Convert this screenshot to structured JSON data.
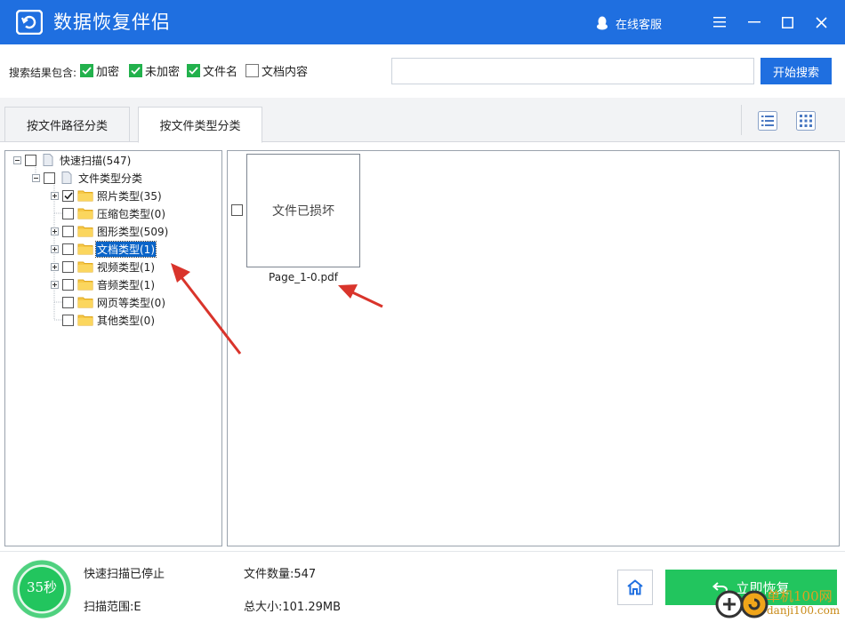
{
  "app": {
    "title": "数据恢复伴侣",
    "support_label": "在线客服"
  },
  "search": {
    "label": "搜索结果包含:",
    "options": [
      {
        "label": "加密",
        "checked": true
      },
      {
        "label": "未加密",
        "checked": true
      },
      {
        "label": "文件名",
        "checked": true
      },
      {
        "label": "文档内容",
        "checked": false
      }
    ],
    "input_value": "",
    "input_placeholder": "",
    "button_label": "开始搜索"
  },
  "tabs": [
    {
      "label": "按文件路径分类",
      "active": false
    },
    {
      "label": "按文件类型分类",
      "active": true
    }
  ],
  "tree": {
    "root": {
      "label": "快速扫描(547)",
      "checked": false
    },
    "group": {
      "label": "文件类型分类",
      "checked": false
    },
    "items": [
      {
        "label": "照片类型(35)",
        "checked": true,
        "expandable": true,
        "selected": false
      },
      {
        "label": "压缩包类型(0)",
        "checked": false,
        "expandable": false,
        "selected": false
      },
      {
        "label": "图形类型(509)",
        "checked": false,
        "expandable": true,
        "selected": false
      },
      {
        "label": "文档类型(1)",
        "checked": false,
        "expandable": true,
        "selected": true
      },
      {
        "label": "视频类型(1)",
        "checked": false,
        "expandable": true,
        "selected": false
      },
      {
        "label": "音频类型(1)",
        "checked": false,
        "expandable": true,
        "selected": false
      },
      {
        "label": "网页等类型(0)",
        "checked": false,
        "expandable": false,
        "selected": false
      },
      {
        "label": "其他类型(0)",
        "checked": false,
        "expandable": false,
        "selected": false
      }
    ]
  },
  "files": [
    {
      "thumbnail_text": "文件已损坏",
      "name": "Page_1-0.pdf",
      "checked": false
    }
  ],
  "status": {
    "timer": "35秒",
    "scan_state": "快速扫描已停止",
    "scan_range": "扫描范围:E",
    "file_count": "文件数量:547",
    "total_size": "总大小:101.29MB",
    "recover_label": "立即恢复"
  },
  "watermark": {
    "site": "单机100网",
    "url": "danji100.com"
  },
  "colors": {
    "primary": "#1f6fe0",
    "success": "#22c55e",
    "checkbox_green": "#22b14c",
    "selection": "#0a64c8",
    "annotation_arrow": "#d9342b"
  }
}
